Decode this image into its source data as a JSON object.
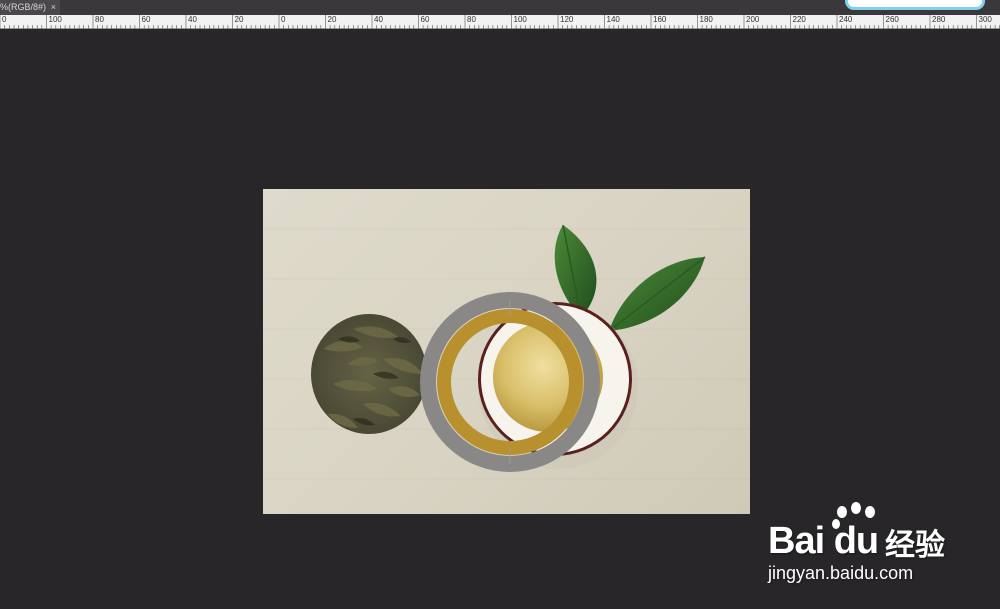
{
  "document_tab": {
    "title": "%(RGB/8#)",
    "close_glyph": "×"
  },
  "ruler": {
    "labels": [
      "0",
      "100",
      "80",
      "60",
      "40",
      "20",
      "0",
      "20",
      "40",
      "60",
      "80",
      "100",
      "120",
      "140",
      "160",
      "180",
      "200",
      "220",
      "240",
      "260",
      "280",
      "300"
    ]
  },
  "canvas_image": {
    "description_icon": "tea-image",
    "ring_outer_color": "#8a8886",
    "ring_inner_color": "#b8912e"
  },
  "watermark": {
    "brand": "Bai du",
    "product": "经验",
    "url": "jingyan.baidu.com"
  }
}
